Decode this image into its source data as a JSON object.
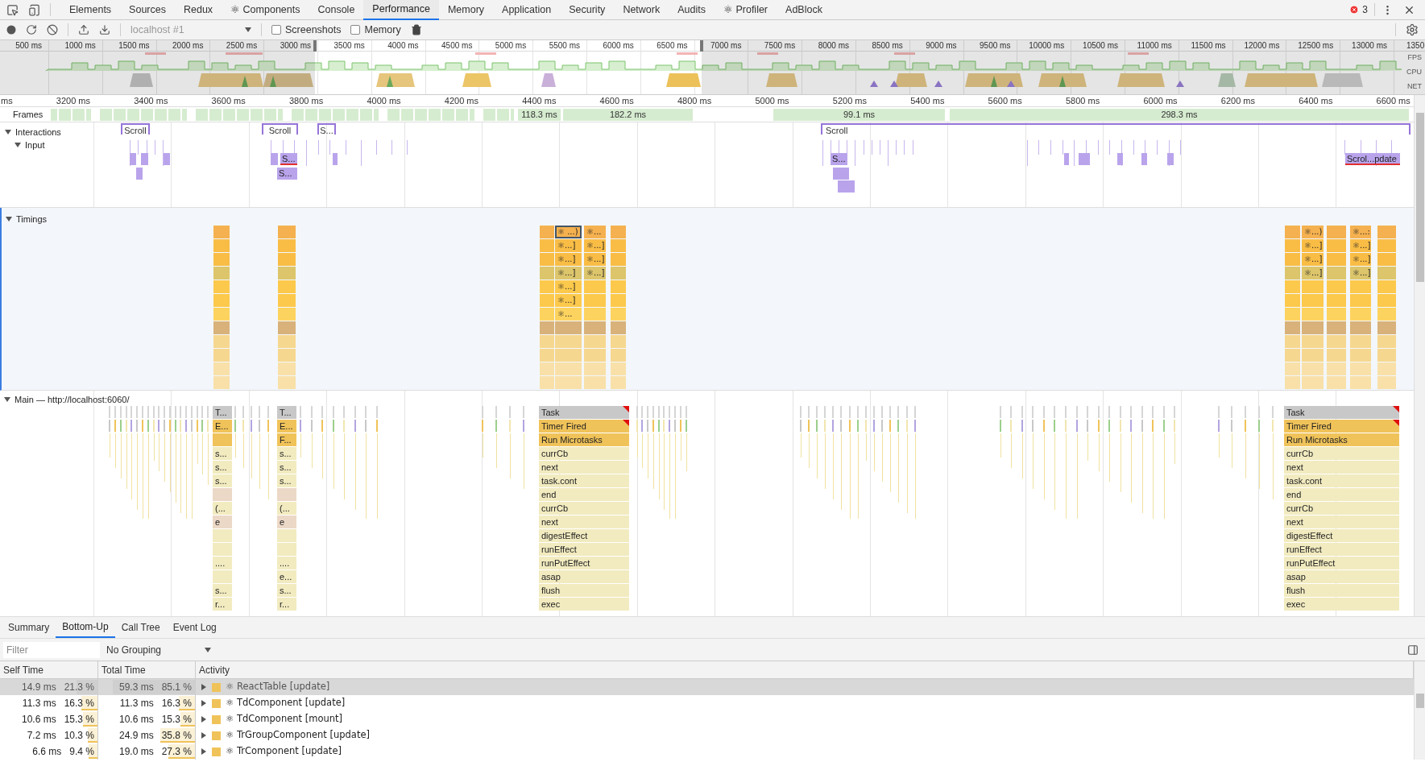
{
  "devtools_tabs": [
    {
      "label": "Elements",
      "selected": false
    },
    {
      "label": "Sources",
      "selected": false
    },
    {
      "label": "Redux",
      "selected": false
    },
    {
      "label": "⚛ Components",
      "selected": false
    },
    {
      "label": "Console",
      "selected": false
    },
    {
      "label": "Performance",
      "selected": true
    },
    {
      "label": "Memory",
      "selected": false
    },
    {
      "label": "Application",
      "selected": false
    },
    {
      "label": "Security",
      "selected": false
    },
    {
      "label": "Network",
      "selected": false
    },
    {
      "label": "Audits",
      "selected": false
    },
    {
      "label": "⚛ Profiler",
      "selected": false
    },
    {
      "label": "AdBlock",
      "selected": false
    }
  ],
  "error_count": "3",
  "toolbar": {
    "profile_select": "localhost #1",
    "checkboxes": [
      {
        "label": "Screenshots",
        "checked": false
      },
      {
        "label": "Memory",
        "checked": false
      }
    ]
  },
  "overview": {
    "ticks": [
      "500 ms",
      "1000 ms",
      "1500 ms",
      "2000 ms",
      "2500 ms",
      "3000 ms",
      "3500 ms",
      "4000 ms",
      "4500 ms",
      "5000 ms",
      "5500 ms",
      "6000 ms",
      "6500 ms",
      "7000 ms",
      "7500 ms",
      "8000 ms",
      "8500 ms",
      "9000 ms",
      "9500 ms",
      "10000 ms",
      "10500 ms",
      "11000 ms",
      "11500 ms",
      "12000 ms",
      "12500 ms",
      "13000 ms",
      "1350"
    ],
    "lanes": [
      "FPS",
      "CPU",
      "NET"
    ]
  },
  "ruler": {
    "ticks": [
      "ms",
      "3200 ms",
      "3400 ms",
      "3600 ms",
      "3800 ms",
      "4000 ms",
      "4200 ms",
      "4400 ms",
      "4600 ms",
      "4800 ms",
      "5000 ms",
      "5200 ms",
      "5400 ms",
      "5600 ms",
      "5800 ms",
      "6000 ms",
      "6200 ms",
      "6400 ms",
      "6600 ms"
    ]
  },
  "frames": {
    "title": "Frames",
    "durations": [
      "118.3 ms",
      "182.2 ms",
      "99.1 ms",
      "298.3 ms"
    ]
  },
  "interactions": {
    "title": "Interactions",
    "expanded": true,
    "scrolls": [
      "Scroll",
      "Scroll",
      "S...",
      "Scroll"
    ],
    "input": {
      "title": "Input",
      "expanded": true,
      "events": [
        {
          "label": "S...",
          "warning": true
        },
        {
          "label": "S...",
          "warning": false
        },
        {
          "label": "S...",
          "warning": false
        },
        {
          "label": "Scrol...pdate",
          "warning": true
        }
      ]
    }
  },
  "timings": {
    "title": "Timings",
    "expanded": true,
    "columns": [
      {
        "kind": "plain"
      },
      {
        "kind": "plain"
      },
      {
        "kind": "plain"
      },
      {
        "kind": "labeled",
        "labels": [
          {
            "text": "⚛ ...)",
            "selected": true
          },
          {
            "text": "⚛...]",
            "selected": false
          },
          {
            "text": "⚛...]",
            "selected": false
          },
          {
            "text": "⚛...]",
            "selected": false
          },
          {
            "text": "⚛...]",
            "selected": false
          },
          {
            "text": "⚛...]",
            "selected": false
          },
          {
            "text": "⚛...",
            "selected": false
          }
        ]
      },
      {
        "kind": "labeled",
        "labels": [
          {
            "text": "⚛...",
            "selected": false
          },
          {
            "text": "⚛...]",
            "selected": false
          },
          {
            "text": "⚛...]",
            "selected": false
          },
          {
            "text": "⚛...]",
            "selected": false
          }
        ]
      },
      {
        "kind": "plain"
      },
      {
        "kind": "plain"
      },
      {
        "kind": "labeled",
        "labels": [
          {
            "text": "⚛...)",
            "selected": false
          },
          {
            "text": "⚛...]",
            "selected": false
          },
          {
            "text": "⚛...]",
            "selected": false
          },
          {
            "text": "⚛...]",
            "selected": false
          }
        ]
      },
      {
        "kind": "plain"
      },
      {
        "kind": "labeled",
        "labels": [
          {
            "text": "⚛...:",
            "selected": false
          },
          {
            "text": "⚛...]",
            "selected": false
          },
          {
            "text": "⚛...]",
            "selected": false
          },
          {
            "text": "⚛...]",
            "selected": false
          }
        ]
      },
      {
        "kind": "plain"
      }
    ]
  },
  "main": {
    "title": "Main — http://localhost:6060/",
    "expanded": true,
    "stacks": [
      {
        "entries": [
          {
            "label": "T...",
            "kind": "task",
            "warning": false
          },
          {
            "label": "E...",
            "kind": "event",
            "warning": false
          },
          {
            "kind": "event",
            "warning": false
          },
          {
            "label": "s...",
            "kind": "function",
            "warning": false
          },
          {
            "label": "s...",
            "kind": "function",
            "warning": false
          },
          {
            "label": "s...",
            "kind": "function",
            "warning": false
          },
          {
            "kind": "native",
            "warning": false
          },
          {
            "label": "(...",
            "kind": "function",
            "warning": false
          },
          {
            "label": "e",
            "kind": "native",
            "warning": false
          },
          {
            "kind": "function",
            "warning": false
          },
          {
            "kind": "function",
            "warning": false
          },
          {
            "label": "....",
            "kind": "function",
            "warning": false
          },
          {
            "kind": "function",
            "warning": false
          },
          {
            "label": "s...",
            "kind": "function",
            "warning": false
          },
          {
            "label": "r...",
            "kind": "function",
            "warning": false
          }
        ]
      },
      {
        "entries": [
          {
            "label": "T...",
            "kind": "task",
            "warning": false
          },
          {
            "label": "E...",
            "kind": "event",
            "warning": false
          },
          {
            "label": "F...",
            "kind": "event",
            "warning": false
          },
          {
            "label": "s...",
            "kind": "function",
            "warning": false
          },
          {
            "label": "s...",
            "kind": "function",
            "warning": false
          },
          {
            "label": "s...",
            "kind": "function",
            "warning": false
          },
          {
            "kind": "native",
            "warning": false
          },
          {
            "label": "(...",
            "kind": "function",
            "warning": false
          },
          {
            "label": "e",
            "kind": "native",
            "warning": false
          },
          {
            "kind": "function",
            "warning": false
          },
          {
            "kind": "function",
            "warning": false
          },
          {
            "label": "....",
            "kind": "function",
            "warning": false
          },
          {
            "label": "e...",
            "kind": "function",
            "warning": false
          },
          {
            "label": "s...",
            "kind": "function",
            "warning": false
          },
          {
            "label": "r...",
            "kind": "function",
            "warning": false
          }
        ]
      },
      {
        "entries": [
          {
            "label": "Task",
            "kind": "task",
            "warning": true
          },
          {
            "label": "Timer Fired",
            "kind": "event",
            "warning": true
          },
          {
            "label": "Run Microtasks",
            "kind": "event",
            "warning": false
          },
          {
            "label": "currCb",
            "kind": "function",
            "warning": false
          },
          {
            "label": "next",
            "kind": "function",
            "warning": false
          },
          {
            "label": "task.cont",
            "kind": "function",
            "warning": false
          },
          {
            "label": "end",
            "kind": "function",
            "warning": false
          },
          {
            "label": "currCb",
            "kind": "function",
            "warning": false
          },
          {
            "label": "next",
            "kind": "function",
            "warning": false
          },
          {
            "label": "digestEffect",
            "kind": "function",
            "warning": false
          },
          {
            "label": "runEffect",
            "kind": "function",
            "warning": false
          },
          {
            "label": "runPutEffect",
            "kind": "function",
            "warning": false
          },
          {
            "label": "asap",
            "kind": "function",
            "warning": false
          },
          {
            "label": "flush",
            "kind": "function",
            "warning": false
          },
          {
            "label": "exec",
            "kind": "function",
            "warning": false
          }
        ]
      },
      {
        "entries": [
          {
            "label": "Task",
            "kind": "task",
            "warning": true
          },
          {
            "label": "Timer Fired",
            "kind": "event",
            "warning": true
          },
          {
            "label": "Run Microtasks",
            "kind": "event",
            "warning": false
          },
          {
            "label": "currCb",
            "kind": "function",
            "warning": false
          },
          {
            "label": "next",
            "kind": "function",
            "warning": false
          },
          {
            "label": "task.cont",
            "kind": "function",
            "warning": false
          },
          {
            "label": "end",
            "kind": "function",
            "warning": false
          },
          {
            "label": "currCb",
            "kind": "function",
            "warning": false
          },
          {
            "label": "next",
            "kind": "function",
            "warning": false
          },
          {
            "label": "digestEffect",
            "kind": "function",
            "warning": false
          },
          {
            "label": "runEffect",
            "kind": "function",
            "warning": false
          },
          {
            "label": "runPutEffect",
            "kind": "function",
            "warning": false
          },
          {
            "label": "asap",
            "kind": "function",
            "warning": false
          },
          {
            "label": "flush",
            "kind": "function",
            "warning": false
          },
          {
            "label": "exec",
            "kind": "function",
            "warning": false
          }
        ]
      }
    ]
  },
  "details": {
    "tabs": [
      {
        "label": "Summary",
        "selected": false
      },
      {
        "label": "Bottom-Up",
        "selected": true
      },
      {
        "label": "Call Tree",
        "selected": false
      },
      {
        "label": "Event Log",
        "selected": false
      }
    ],
    "filter": {
      "placeholder": "Filter"
    },
    "grouping": "No Grouping",
    "columns": [
      "Self Time",
      "Total Time",
      "Activity"
    ],
    "rows": [
      {
        "self_time": "14.9 ms",
        "self_percent": "21.3 %",
        "self_bar": {
          "level": 0.213
        },
        "total_time": "59.3 ms",
        "total_percent": "85.1 %",
        "total_bar": {
          "level": 0.851
        },
        "activity": "⚛ ReactTable [update]",
        "selected": true,
        "expanded": false
      },
      {
        "self_time": "11.3 ms",
        "self_percent": "16.3 %",
        "self_bar": {
          "level": 0.163
        },
        "total_time": "11.3 ms",
        "total_percent": "16.3 %",
        "total_bar": {
          "level": 0.163
        },
        "activity": "⚛ TdComponent [update]",
        "selected": false,
        "expanded": false
      },
      {
        "self_time": "10.6 ms",
        "self_percent": "15.3 %",
        "self_bar": {
          "level": 0.153
        },
        "total_time": "10.6 ms",
        "total_percent": "15.3 %",
        "total_bar": {
          "level": 0.153
        },
        "activity": "⚛ TdComponent [mount]",
        "selected": false,
        "expanded": false
      },
      {
        "self_time": "7.2 ms",
        "self_percent": "10.3 %",
        "self_bar": {
          "level": 0.103
        },
        "total_time": "24.9 ms",
        "total_percent": "35.8 %",
        "total_bar": {
          "level": 0.358
        },
        "activity": "⚛ TrGroupComponent [update]",
        "selected": false,
        "expanded": false
      },
      {
        "self_time": "6.6 ms",
        "self_percent": "9.4 %",
        "self_bar": {
          "level": 0.094
        },
        "total_time": "19.0 ms",
        "total_percent": "27.3 %",
        "total_bar": {
          "level": 0.273
        },
        "activity": "⚛ TrComponent [update]",
        "selected": false,
        "expanded": false
      }
    ]
  }
}
